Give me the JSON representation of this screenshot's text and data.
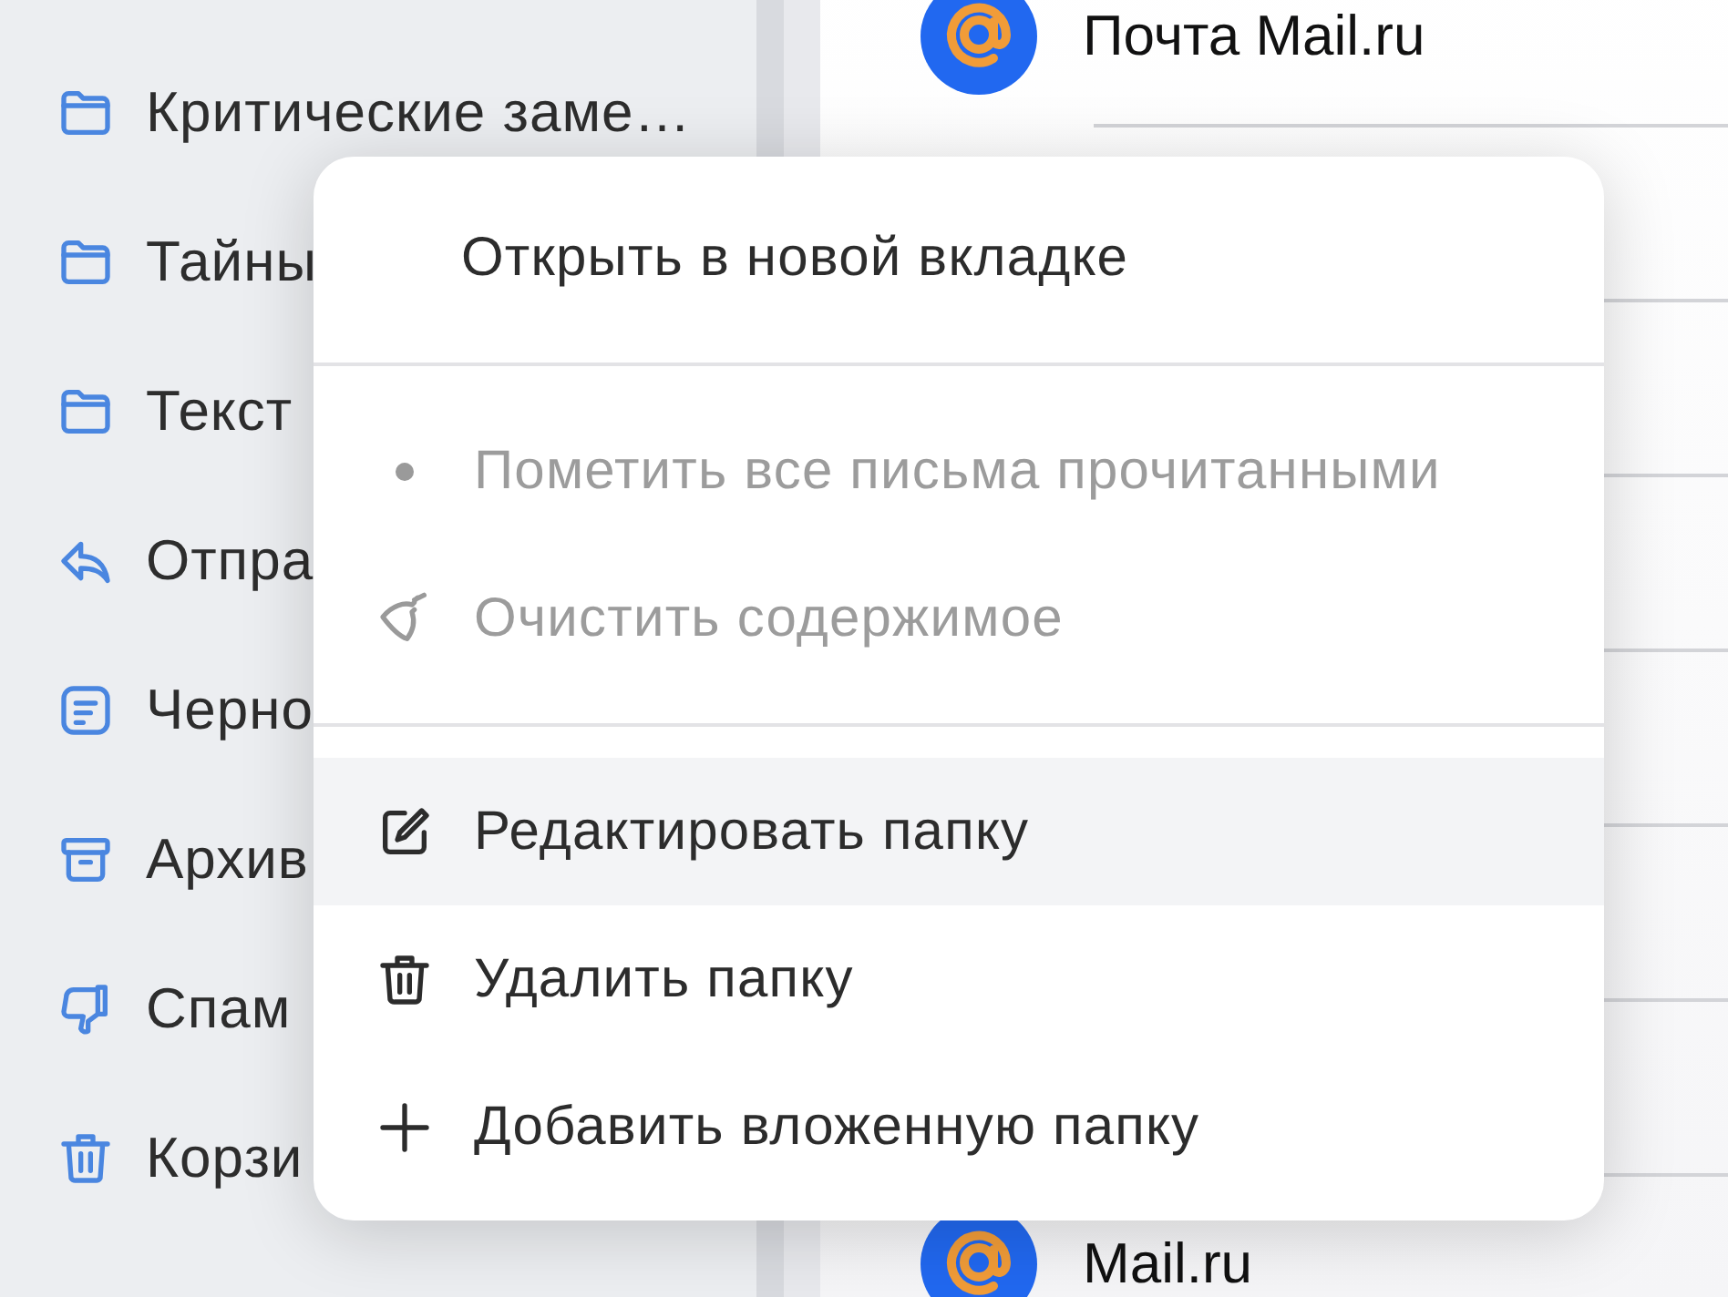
{
  "sidebar": {
    "items": [
      {
        "label": "Критические заме…",
        "kind": "folder"
      },
      {
        "label": "Тайны",
        "kind": "folder"
      },
      {
        "label": "Текст",
        "kind": "folder"
      },
      {
        "label": "Отпра",
        "kind": "sent"
      },
      {
        "label": "Черно",
        "kind": "drafts"
      },
      {
        "label": "Архив",
        "kind": "archive"
      },
      {
        "label": "Спам",
        "kind": "spam"
      },
      {
        "label": "Корзи",
        "kind": "trash"
      }
    ]
  },
  "mail_list": {
    "rows": [
      {
        "sender": "Почта Mail.ru"
      },
      {
        "sender": "Mail.ru"
      }
    ]
  },
  "context_menu": {
    "sections": [
      {
        "items": [
          {
            "label": "Открыть в новой вкладке",
            "kind": "none",
            "disabled": false,
            "selected": false
          }
        ]
      },
      {
        "items": [
          {
            "label": "Пометить все письма прочитанными",
            "kind": "dot",
            "disabled": true,
            "selected": false
          },
          {
            "label": "Очистить содержимое",
            "kind": "broom",
            "disabled": true,
            "selected": false
          }
        ]
      },
      {
        "items": [
          {
            "label": "Редактировать папку",
            "kind": "edit",
            "disabled": false,
            "selected": true
          },
          {
            "label": "Удалить папку",
            "kind": "trash",
            "disabled": false,
            "selected": false
          },
          {
            "label": "Добавить вложенную папку",
            "kind": "plus",
            "disabled": false,
            "selected": false
          }
        ]
      }
    ]
  }
}
